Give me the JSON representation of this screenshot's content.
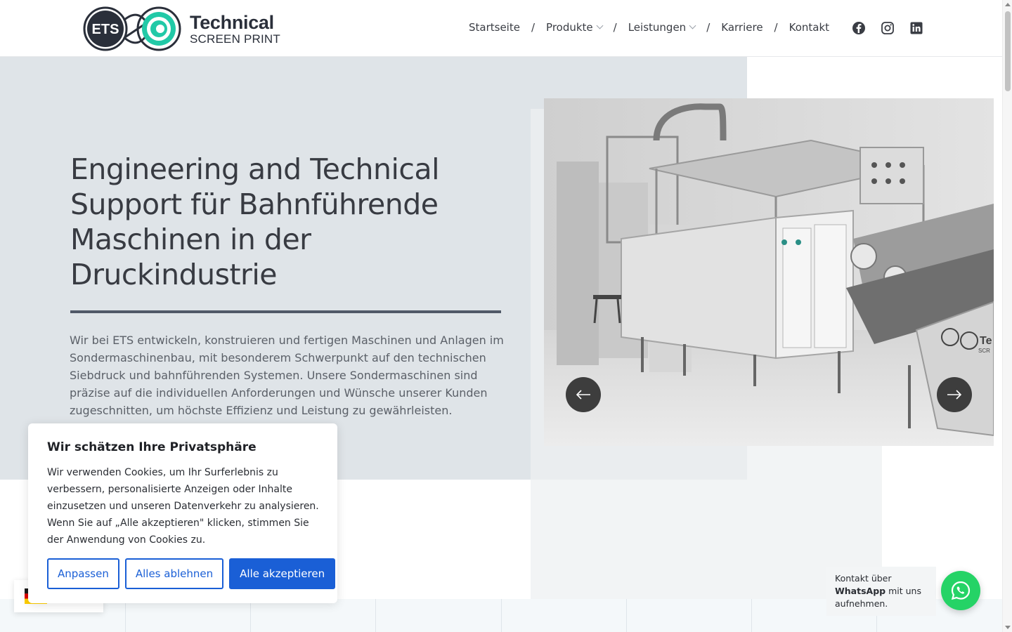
{
  "logo": {
    "mark_text": "ETS",
    "line1": "Technical",
    "line2": "SCREEN PRINT"
  },
  "nav": {
    "items": [
      {
        "label": "Startseite"
      },
      {
        "label": "Produkte"
      },
      {
        "label": "Leistungen"
      },
      {
        "label": "Karriere"
      },
      {
        "label": "Kontakt"
      }
    ],
    "separator": "/"
  },
  "socials": [
    "facebook-icon",
    "instagram-icon",
    "linkedin-icon"
  ],
  "hero": {
    "title": "Engineering and Technical Support für Bahnführende Maschinen in der Druckindustrie",
    "text": "Wir bei ETS entwickeln, konstruieren und fertigen Maschinen und Anlagen im Sondermaschinenbau, mit besonderem Schwerpunkt auf den technischen Siebdruck und bahnführenden Systemen. Unsere Sondermaschinen sind präzise auf die individuellen Anforderungen und Wünsche unserer Kunden zugeschnitten, um höchste Effizienz und Leistung zu gewährleisten."
  },
  "carousel": {
    "machine_brand_text": "Te",
    "machine_sub_text": "SCR"
  },
  "cookie": {
    "title": "Wir schätzen Ihre Privatsphäre",
    "text": "Wir verwenden Cookies, um Ihr Surferlebnis zu verbessern, personalisierte Anzeigen oder Inhalte einzusetzen und unseren Datenverkehr zu analysieren. Wenn Sie auf „Alle akzeptieren\" klicken, stimmen Sie der Anwendung von Cookies zu.",
    "btn_customize": "Anpassen",
    "btn_reject": "Alles ablehnen",
    "btn_accept": "Alle akzeptieren"
  },
  "whatsapp": {
    "line1": "Kontakt über",
    "bold": "WhatsApp",
    "rest": " mit uns aufnehmen."
  },
  "colors": {
    "accent": "#1a5fd6",
    "hero_bg": "#dfe4e8",
    "whatsapp": "#25d366",
    "logo_teal": "#21c9a7"
  }
}
